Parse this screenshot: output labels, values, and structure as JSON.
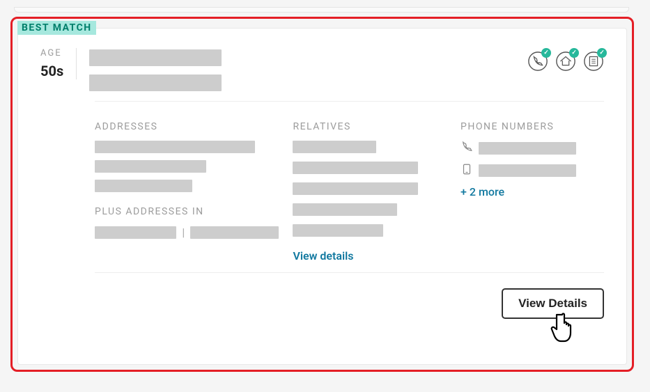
{
  "badge": {
    "label": "BEST MATCH"
  },
  "age": {
    "label": "AGE",
    "value": "50s"
  },
  "sections": {
    "addresses": {
      "heading": "ADDRESSES",
      "plus_heading": "PLUS ADDRESSES IN"
    },
    "relatives": {
      "heading": "RELATIVES",
      "view_details": "View details"
    },
    "phones": {
      "heading": "PHONE NUMBERS",
      "more": "+ 2 more"
    }
  },
  "footer": {
    "button": "View Details"
  }
}
